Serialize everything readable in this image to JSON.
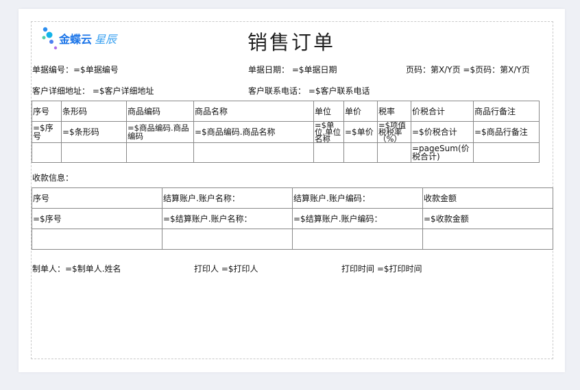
{
  "logo": {
    "brand": "金蝶云",
    "sub": "星辰"
  },
  "title": "销售订单",
  "header": {
    "bill_no": "单据编号：=$单据编号",
    "bill_date": "单据日期：  =$单据日期",
    "page": "页码：第X/Y页  =$页码：第X/Y页",
    "address": "客户详细地址：  =$客户详细地址",
    "phone": "客户联系电话：  =$客户联系电话"
  },
  "goods_table": {
    "headers": [
      "序号",
      "条形码",
      "商品编码",
      "商品名称",
      "单位",
      "单价",
      "税率",
      "价税合计",
      "商品行备注"
    ],
    "row": [
      "=$序号",
      "=$条形码",
      "=$商品编码.商品编码",
      "=$商品编码.商品名称",
      "=$单位.单位名称",
      "=$单价",
      "=$项值税税率（%）",
      "=$价税合计",
      "=$商品行备注"
    ],
    "sum": "=pageSum(价税合计)"
  },
  "payment": {
    "label": "收款信息：",
    "headers": [
      "序号",
      "结算账户.账户名称：",
      "结算账户.账户编码：",
      "收款金额"
    ],
    "row": [
      "=$序号",
      "=$结算账户.账户名称：",
      "=$结算账户.账户编码：",
      "=$收款金额"
    ]
  },
  "footer": {
    "maker": "制单人：=$制单人.姓名",
    "printer": "打印人  =$打印人",
    "print_time": "打印时间  =$打印时间"
  }
}
